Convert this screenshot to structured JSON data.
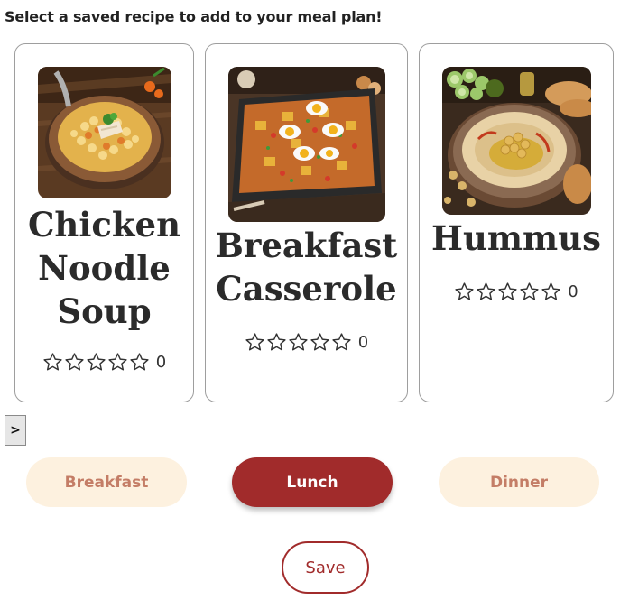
{
  "heading": "Select a saved recipe to add to your meal plan!",
  "recipes": [
    {
      "title": "Chicken Noodle Soup",
      "rating_count": "0",
      "stars": 0,
      "image_icon": "soup-bowl-image"
    },
    {
      "title": "Breakfast Casserole",
      "rating_count": "0",
      "stars": 0,
      "image_icon": "casserole-dish-image"
    },
    {
      "title": "Hummus",
      "rating_count": "0",
      "stars": 0,
      "image_icon": "hummus-bowl-image"
    }
  ],
  "carousel": {
    "next_label": ">"
  },
  "meal_types": [
    {
      "label": "Breakfast",
      "selected": false
    },
    {
      "label": "Lunch",
      "selected": true
    },
    {
      "label": "Dinner",
      "selected": false
    }
  ],
  "save_label": "Save",
  "colors": {
    "accent": "#a12b2b",
    "inactive_bg": "#fdf1df",
    "inactive_text": "#c47d66",
    "card_border": "#9e9e9e"
  }
}
